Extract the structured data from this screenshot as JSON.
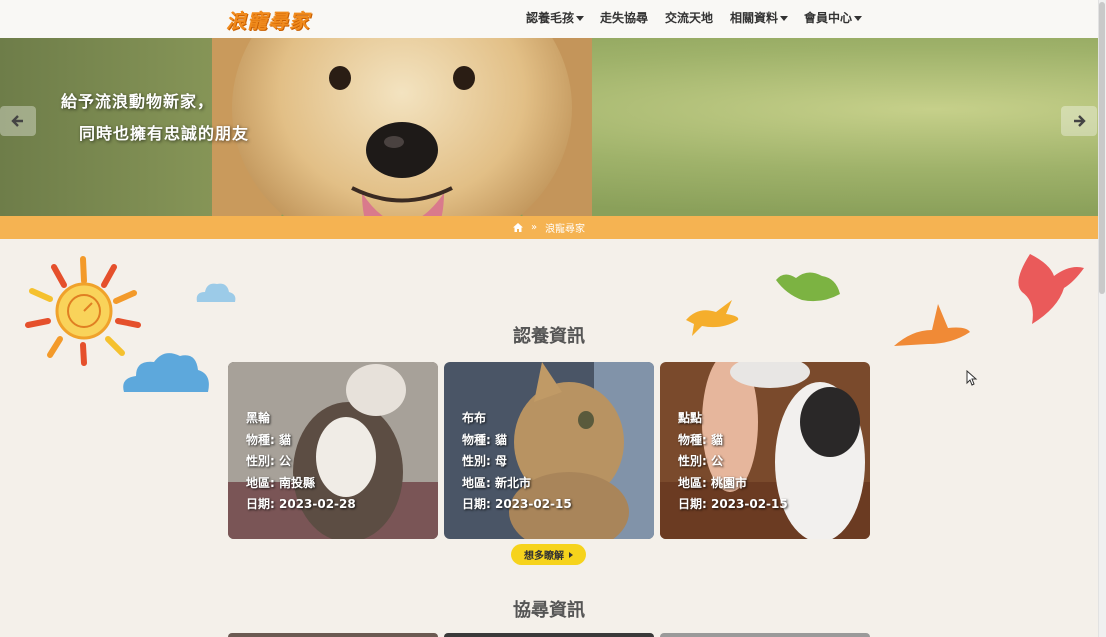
{
  "brand": {
    "logo_text": "浪寵尋家"
  },
  "nav": {
    "items": [
      {
        "label": "認養毛孩",
        "dropdown": true
      },
      {
        "label": "走失協尋",
        "dropdown": false
      },
      {
        "label": "交流天地",
        "dropdown": false
      },
      {
        "label": "相關資料",
        "dropdown": true
      },
      {
        "label": "會員中心",
        "dropdown": true
      }
    ]
  },
  "hero": {
    "line1": "給予流浪動物新家，",
    "line2": "同時也擁有忠誠的朋友"
  },
  "breadcrumb": {
    "home_icon": "home-icon",
    "separator": "»",
    "current": "浪寵尋家"
  },
  "adoption": {
    "title": "認養資訊",
    "cards": [
      {
        "name": "黑輪",
        "species": "物種: 貓",
        "gender": "性別: 公",
        "region": "地區: 南投縣",
        "date": "日期: 2023-02-28"
      },
      {
        "name": "布布",
        "species": "物種: 貓",
        "gender": "性別: 母",
        "region": "地區: 新北市",
        "date": "日期: 2023-02-15"
      },
      {
        "name": "點點",
        "species": "物種: 貓",
        "gender": "性別: 公",
        "region": "地區: 桃園市",
        "date": "日期: 2023-02-15"
      }
    ],
    "more_button": "想多瞭解"
  },
  "search": {
    "title": "協尋資訊"
  },
  "colors": {
    "accent_orange": "#f5b352",
    "logo_orange": "#f08a1c",
    "button_yellow": "#f6d31c",
    "page_bg": "#f4f0ea"
  }
}
